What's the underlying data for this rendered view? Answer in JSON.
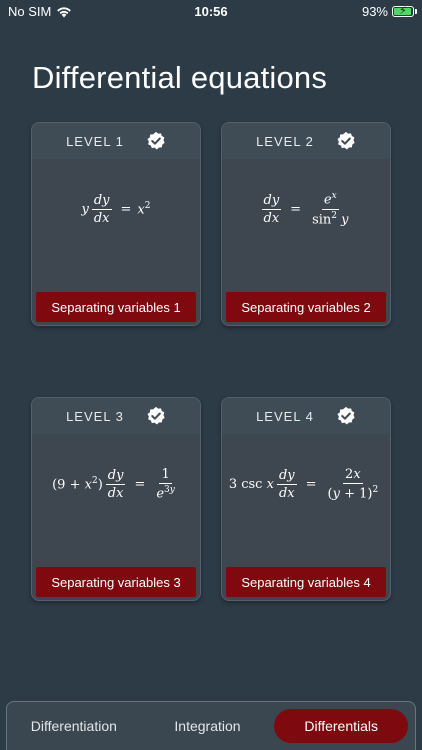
{
  "status": {
    "carrier": "No SIM",
    "time": "10:56",
    "battery": "93%",
    "battery_level": 0.93,
    "battery_color": "#4cd964"
  },
  "page": {
    "title": "Differential equations"
  },
  "colors": {
    "background": "#2d3b47",
    "accent": "#7e0a10",
    "card": "#3e464f"
  },
  "levels": [
    {
      "label": "LEVEL 1",
      "completed": true,
      "topic": "Separating variables 1"
    },
    {
      "label": "LEVEL 2",
      "completed": true,
      "topic": "Separating variables 2"
    },
    {
      "label": "LEVEL 3",
      "completed": true,
      "topic": "Separating variables 3"
    },
    {
      "label": "LEVEL 4",
      "completed": true,
      "topic": "Separating variables 4"
    }
  ],
  "tabs": [
    {
      "label": "Differentiation",
      "active": false
    },
    {
      "label": "Integration",
      "active": false
    },
    {
      "label": "Differentials",
      "active": true
    }
  ]
}
